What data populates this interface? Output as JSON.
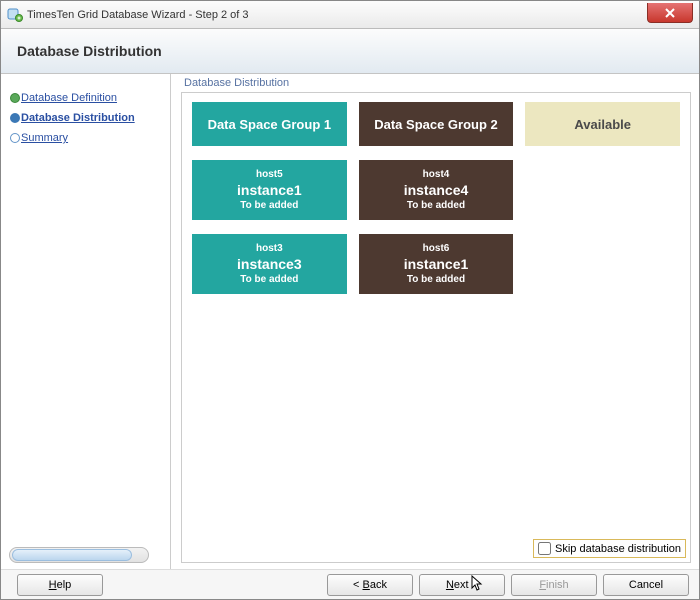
{
  "window": {
    "title": "TimesTen Grid Database Wizard - Step 2 of 3"
  },
  "banner": {
    "title": "Database Distribution"
  },
  "sidebar": {
    "steps": [
      {
        "label": "Database Definition"
      },
      {
        "label": "Database Distribution"
      },
      {
        "label": "Summary"
      }
    ]
  },
  "content": {
    "legend": "Database Distribution",
    "groups": [
      {
        "label": "Data Space Group 1",
        "color": "teal"
      },
      {
        "label": "Data Space Group 2",
        "color": "brown"
      },
      {
        "label": "Available",
        "color": "cream"
      }
    ],
    "rows": [
      [
        {
          "host": "host5",
          "instance": "instance1",
          "status": "To be added",
          "color": "teal"
        },
        {
          "host": "host4",
          "instance": "instance4",
          "status": "To be added",
          "color": "brown"
        },
        null
      ],
      [
        {
          "host": "host3",
          "instance": "instance3",
          "status": "To be added",
          "color": "teal"
        },
        {
          "host": "host6",
          "instance": "instance1",
          "status": "To be added",
          "color": "brown"
        },
        null
      ]
    ],
    "skip_label": "Skip database distribution"
  },
  "footer": {
    "help": "Help",
    "back": "< Back",
    "next": "Next >",
    "finish": "Finish",
    "cancel": "Cancel"
  }
}
